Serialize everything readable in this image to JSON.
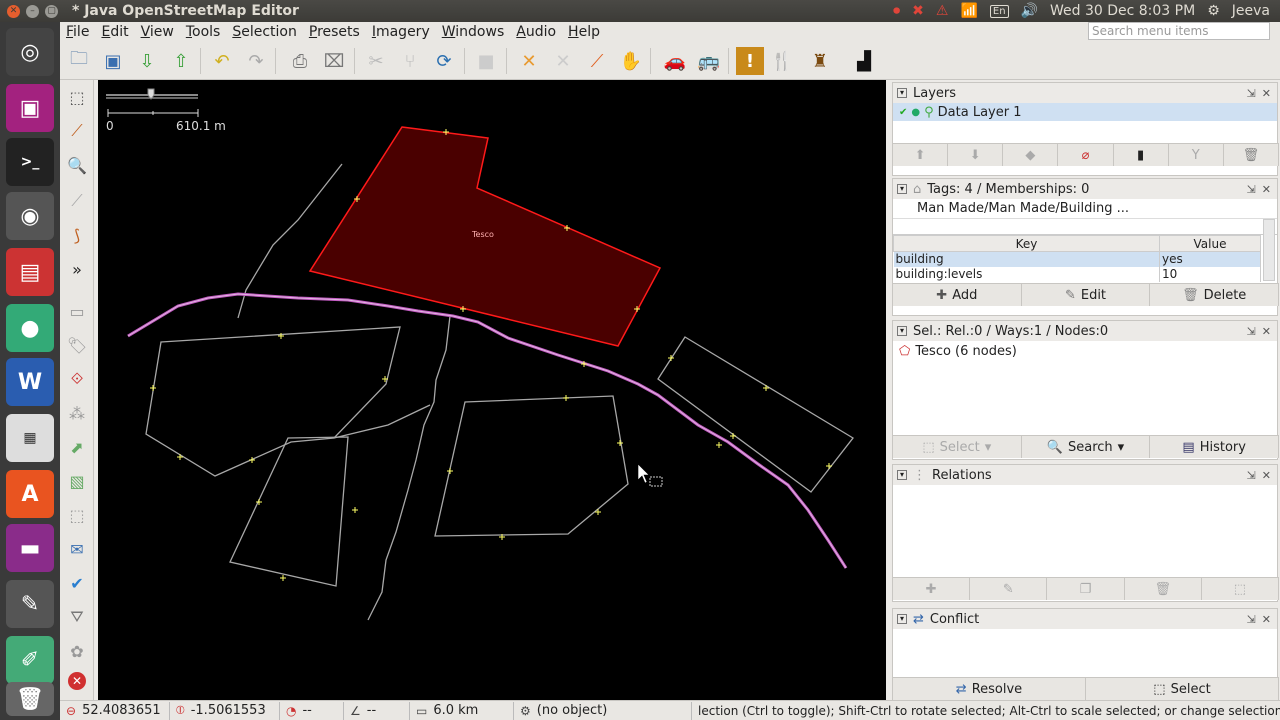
{
  "window": {
    "title": "* Java OpenStreetMap Editor"
  },
  "system_tray": {
    "clock": "Wed 30 Dec  8:03 PM",
    "user": "Jeeva",
    "keyboard": "En"
  },
  "menubar": {
    "items": [
      "File",
      "Edit",
      "View",
      "Tools",
      "Selection",
      "Presets",
      "Imagery",
      "Windows",
      "Audio",
      "Help"
    ],
    "search_placeholder": "Search menu items"
  },
  "map": {
    "scale_start": "0",
    "scale_end": "610.1 m",
    "building_label": "Tesco",
    "colors": {
      "selected": "#ff2020",
      "way": "#b0b0b0",
      "node": "#ffff66",
      "route": "#d9a0d9"
    }
  },
  "layers": {
    "title": "Layers",
    "items": [
      "Data Layer 1"
    ]
  },
  "tags": {
    "title": "Tags: 4 / Memberships: 0",
    "preset": "Man Made/Man Made/Building ...",
    "columns": [
      "Key",
      "Value"
    ],
    "rows": [
      {
        "key": "building",
        "value": "yes"
      },
      {
        "key": "building:levels",
        "value": "10"
      }
    ],
    "buttons": {
      "add": "Add",
      "edit": "Edit",
      "delete": "Delete"
    }
  },
  "selection": {
    "title": "Sel.: Rel.:0 / Ways:1 / Nodes:0",
    "items": [
      "Tesco (6 nodes)"
    ],
    "buttons": {
      "select": "Select",
      "search": "Search",
      "history": "History"
    }
  },
  "relations": {
    "title": "Relations"
  },
  "conflict": {
    "title": "Conflict",
    "buttons": {
      "resolve": "Resolve",
      "select": "Select"
    }
  },
  "statusbar": {
    "lat": "52.4083651",
    "lon": "-1.5061553",
    "heading": "--",
    "angle": "--",
    "distance": "6.0 km",
    "object": "(no object)",
    "help": "lection (Ctrl to toggle); Shift-Ctrl to rotate selected; Alt-Ctrl to scale selected; or change selection"
  }
}
